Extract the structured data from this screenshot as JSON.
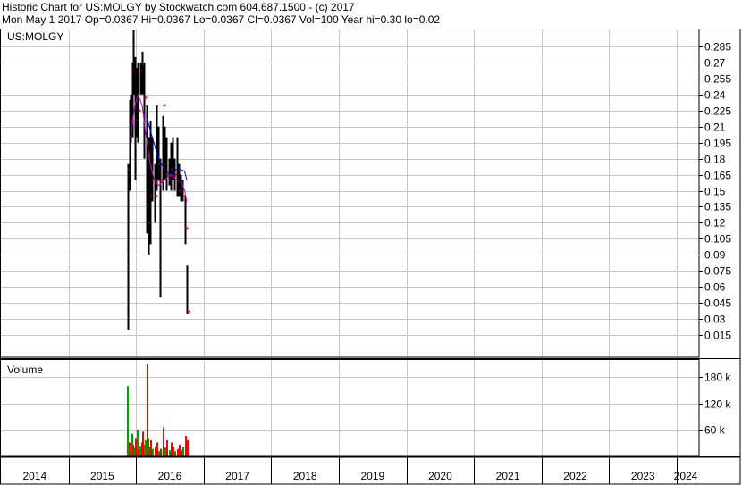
{
  "header": {
    "title_line": "Historic Chart for US:MOLGY by Stockwatch.com 604.687.1500 - (c) 2017",
    "quote_line": "Mon May  1 2017   Op=0.0367   Hi=0.0367   Lo=0.0367   Cl=0.0367   Vol=100   Year hi=0.30   lo=0.02"
  },
  "chart_data": [
    {
      "type": "ohlc",
      "title": "US:MOLGY",
      "ylim": [
        0,
        0.3
      ],
      "y_ticks": [
        "0.285",
        "0.27",
        "0.255",
        "0.24",
        "0.225",
        "0.21",
        "0.195",
        "0.18",
        "0.165",
        "0.15",
        "0.135",
        "0.12",
        "0.105",
        "0.09",
        "0.075",
        "0.06",
        "0.045",
        "0.03",
        "0.015"
      ],
      "x_ticks": [
        "2014",
        "2015",
        "2016",
        "2017",
        "2018",
        "2019",
        "2020",
        "2021",
        "2022",
        "2023",
        "2024"
      ],
      "grid": true,
      "colors": {
        "price_bar": "#000000",
        "close_tick": "#ff0000",
        "ma_short": "#0000ff",
        "ma_long": "#cc00cc",
        "grid": "#c8c8c8"
      },
      "bars": [
        {
          "x": 2015.88,
          "high": 0.175,
          "low": 0.02,
          "close": 0.17
        },
        {
          "x": 2015.9,
          "high": 0.235,
          "low": 0.15,
          "close": 0.23
        },
        {
          "x": 2015.92,
          "high": 0.24,
          "low": 0.195,
          "close": 0.215
        },
        {
          "x": 2015.94,
          "high": 0.27,
          "low": 0.2,
          "close": 0.25
        },
        {
          "x": 2015.96,
          "high": 0.3,
          "low": 0.24,
          "close": 0.262
        },
        {
          "x": 2015.98,
          "high": 0.275,
          "low": 0.16,
          "close": 0.232
        },
        {
          "x": 2016.0,
          "high": 0.265,
          "low": 0.2,
          "close": 0.216
        },
        {
          "x": 2016.03,
          "high": 0.27,
          "low": 0.195,
          "close": 0.225
        },
        {
          "x": 2016.06,
          "high": 0.27,
          "low": 0.24,
          "close": 0.262
        },
        {
          "x": 2016.09,
          "high": 0.28,
          "low": 0.24,
          "close": 0.268
        },
        {
          "x": 2016.12,
          "high": 0.27,
          "low": 0.18,
          "close": 0.237
        },
        {
          "x": 2016.15,
          "high": 0.23,
          "low": 0.11,
          "close": 0.135
        },
        {
          "x": 2016.18,
          "high": 0.2,
          "low": 0.09,
          "close": 0.12
        },
        {
          "x": 2016.21,
          "high": 0.215,
          "low": 0.1,
          "close": 0.145
        },
        {
          "x": 2016.24,
          "high": 0.2,
          "low": 0.14,
          "close": 0.16
        },
        {
          "x": 2016.27,
          "high": 0.175,
          "low": 0.12,
          "close": 0.145
        },
        {
          "x": 2016.3,
          "high": 0.23,
          "low": 0.15,
          "close": 0.16
        },
        {
          "x": 2016.33,
          "high": 0.21,
          "low": 0.16,
          "close": 0.175
        },
        {
          "x": 2016.36,
          "high": 0.18,
          "low": 0.05,
          "close": 0.16
        },
        {
          "x": 2016.39,
          "high": 0.22,
          "low": 0.15,
          "close": 0.23
        },
        {
          "x": 2016.42,
          "high": 0.21,
          "low": 0.16,
          "close": 0.175
        },
        {
          "x": 2016.45,
          "high": 0.2,
          "low": 0.15,
          "close": 0.165
        },
        {
          "x": 2016.48,
          "high": 0.18,
          "low": 0.155,
          "close": 0.16
        },
        {
          "x": 2016.51,
          "high": 0.195,
          "low": 0.15,
          "close": 0.17
        },
        {
          "x": 2016.54,
          "high": 0.2,
          "low": 0.16,
          "close": 0.165
        },
        {
          "x": 2016.57,
          "high": 0.18,
          "low": 0.15,
          "close": 0.165
        },
        {
          "x": 2016.6,
          "high": 0.2,
          "low": 0.145,
          "close": 0.16
        },
        {
          "x": 2016.63,
          "high": 0.175,
          "low": 0.145,
          "close": 0.15
        },
        {
          "x": 2016.66,
          "high": 0.165,
          "low": 0.14,
          "close": 0.15
        },
        {
          "x": 2016.69,
          "high": 0.16,
          "low": 0.14,
          "close": 0.145
        },
        {
          "x": 2016.72,
          "high": 0.145,
          "low": 0.1,
          "close": 0.115
        },
        {
          "x": 2016.75,
          "high": 0.08,
          "low": 0.035,
          "close": 0.037
        }
      ],
      "ma_short": [
        [
          2016.15,
          0.22
        ],
        [
          2016.24,
          0.2
        ],
        [
          2016.33,
          0.18
        ],
        [
          2016.42,
          0.17
        ],
        [
          2016.51,
          0.165
        ],
        [
          2016.6,
          0.17
        ],
        [
          2016.66,
          0.17
        ],
        [
          2016.72,
          0.168
        ],
        [
          2016.75,
          0.16
        ]
      ],
      "ma_long": [
        [
          2015.92,
          0.2
        ],
        [
          2015.98,
          0.23
        ],
        [
          2016.03,
          0.24
        ],
        [
          2016.09,
          0.23
        ],
        [
          2016.15,
          0.2
        ],
        [
          2016.21,
          0.175
        ],
        [
          2016.27,
          0.16
        ],
        [
          2016.33,
          0.155
        ],
        [
          2016.42,
          0.16
        ],
        [
          2016.51,
          0.165
        ],
        [
          2016.6,
          0.16
        ],
        [
          2016.66,
          0.16
        ],
        [
          2016.72,
          0.15
        ],
        [
          2016.75,
          0.14
        ]
      ]
    },
    {
      "type": "bar",
      "title": "Volume",
      "ylim": [
        0,
        220
      ],
      "y_ticks": [
        "180 k",
        "120 k",
        "60 k"
      ],
      "y_tick_values": [
        180,
        120,
        60
      ],
      "colors": {
        "up": "#00a000",
        "down": "#ff0000",
        "grid": "#c8c8c8"
      },
      "bars": [
        {
          "x": 2015.87,
          "value": 160,
          "dir": "up"
        },
        {
          "x": 2015.89,
          "value": 30,
          "dir": "down"
        },
        {
          "x": 2015.91,
          "value": 20,
          "dir": "up"
        },
        {
          "x": 2015.93,
          "value": 50,
          "dir": "up"
        },
        {
          "x": 2015.95,
          "value": 25,
          "dir": "down"
        },
        {
          "x": 2015.97,
          "value": 18,
          "dir": "up"
        },
        {
          "x": 2015.99,
          "value": 40,
          "dir": "down"
        },
        {
          "x": 2016.01,
          "value": 60,
          "dir": "up"
        },
        {
          "x": 2016.03,
          "value": 15,
          "dir": "down"
        },
        {
          "x": 2016.05,
          "value": 22,
          "dir": "up"
        },
        {
          "x": 2016.07,
          "value": 30,
          "dir": "down"
        },
        {
          "x": 2016.09,
          "value": 55,
          "dir": "down"
        },
        {
          "x": 2016.11,
          "value": 25,
          "dir": "up"
        },
        {
          "x": 2016.13,
          "value": 35,
          "dir": "up"
        },
        {
          "x": 2016.15,
          "value": 210,
          "dir": "down"
        },
        {
          "x": 2016.17,
          "value": 40,
          "dir": "up"
        },
        {
          "x": 2016.19,
          "value": 20,
          "dir": "down"
        },
        {
          "x": 2016.21,
          "value": 35,
          "dir": "down"
        },
        {
          "x": 2016.24,
          "value": 15,
          "dir": "up"
        },
        {
          "x": 2016.27,
          "value": 20,
          "dir": "down"
        },
        {
          "x": 2016.3,
          "value": 30,
          "dir": "down"
        },
        {
          "x": 2016.33,
          "value": 10,
          "dir": "up"
        },
        {
          "x": 2016.36,
          "value": 15,
          "dir": "down"
        },
        {
          "x": 2016.39,
          "value": 65,
          "dir": "down"
        },
        {
          "x": 2016.42,
          "value": 18,
          "dir": "up"
        },
        {
          "x": 2016.45,
          "value": 35,
          "dir": "down"
        },
        {
          "x": 2016.48,
          "value": 12,
          "dir": "up"
        },
        {
          "x": 2016.51,
          "value": 30,
          "dir": "down"
        },
        {
          "x": 2016.54,
          "value": 20,
          "dir": "down"
        },
        {
          "x": 2016.57,
          "value": 10,
          "dir": "up"
        },
        {
          "x": 2016.6,
          "value": 15,
          "dir": "down"
        },
        {
          "x": 2016.63,
          "value": 25,
          "dir": "down"
        },
        {
          "x": 2016.66,
          "value": 12,
          "dir": "down"
        },
        {
          "x": 2016.69,
          "value": 20,
          "dir": "up"
        },
        {
          "x": 2016.72,
          "value": 45,
          "dir": "down"
        },
        {
          "x": 2016.75,
          "value": 35,
          "dir": "down"
        }
      ]
    }
  ]
}
